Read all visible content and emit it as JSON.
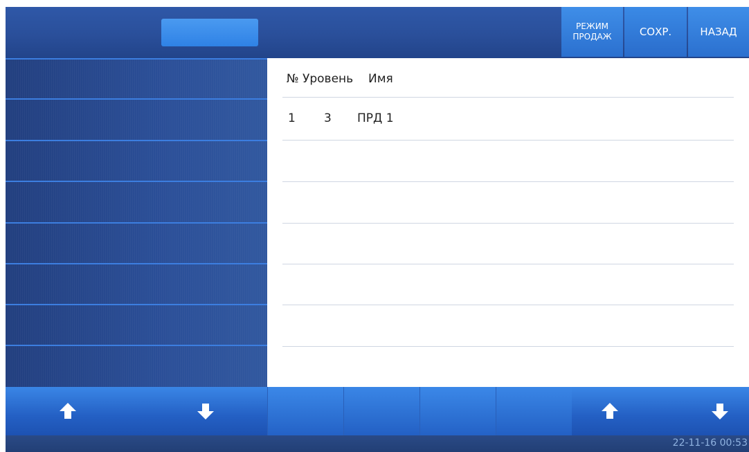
{
  "topbar": {
    "sales_mode_line1": "РЕЖИМ",
    "sales_mode_line2": "ПРОДАЖ",
    "save_label": "СОХР.",
    "back_label": "НАЗАД"
  },
  "list": {
    "headers": {
      "number": "№",
      "level": "Уровень",
      "name": "Имя"
    },
    "rows": [
      {
        "number": "1",
        "level": "3",
        "name": "ПРД 1"
      }
    ]
  },
  "bottombar": {
    "left_up_icon": "arrow-up-icon",
    "left_down_icon": "arrow-down-icon",
    "right_up_icon": "arrow-up-icon",
    "right_down_icon": "arrow-down-icon"
  },
  "status": {
    "datetime": "22-11-16  00:53"
  },
  "colors": {
    "accent": "#2f82e6",
    "panel": "#2b4f98",
    "statusText": "#8fb2e0"
  }
}
